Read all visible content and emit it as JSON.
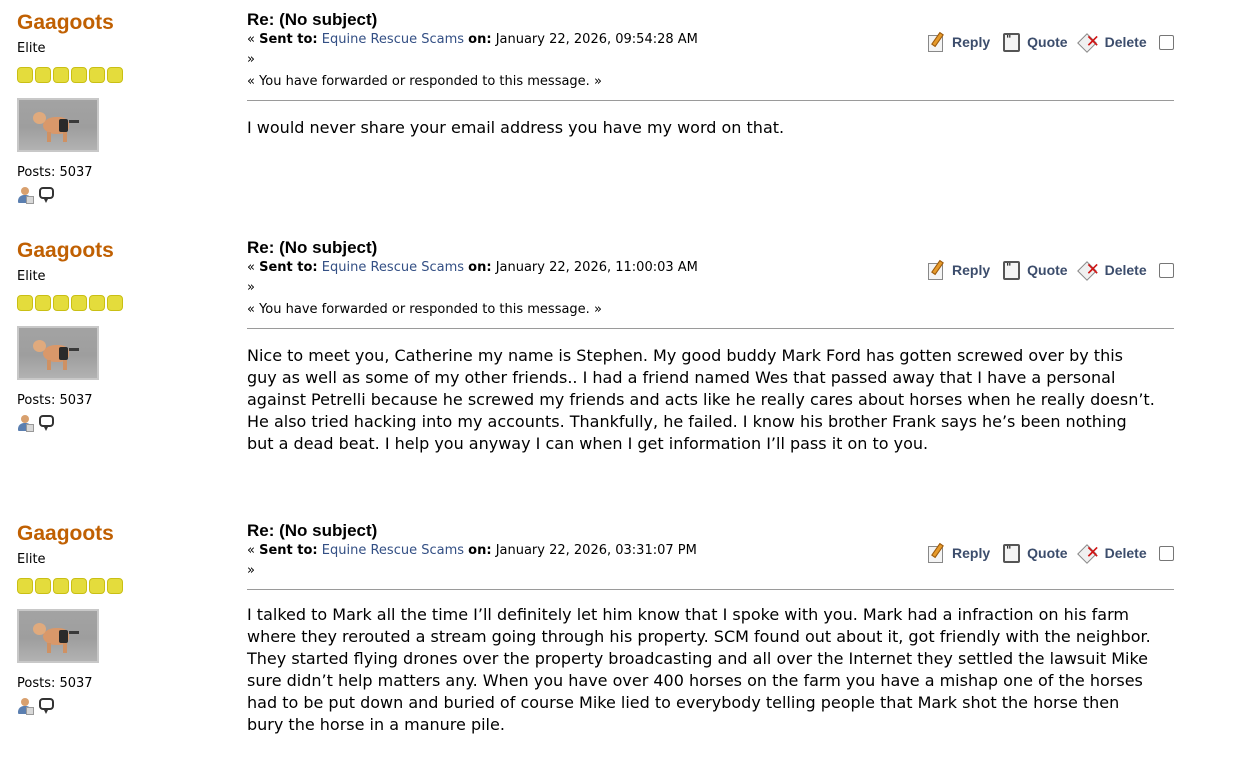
{
  "labels": {
    "sent_to": "Sent to:",
    "on": "on:",
    "open_quote": "«",
    "close_quote": "»",
    "reply": "Reply",
    "quote": "Quote",
    "delete": "Delete"
  },
  "posts": [
    {
      "poster_name": "Gaagoots",
      "poster_group": "Elite",
      "posts_count": "Posts: 5037",
      "subject": "Re: (No subject)",
      "recipient": "Equine Rescue Scams",
      "date": "January 22, 2026, 09:54:28 AM",
      "forwarded_note": "« You have forwarded or responded to this message. »",
      "body": "I would never share your email address you have my word on that."
    },
    {
      "poster_name": "Gaagoots",
      "poster_group": "Elite",
      "posts_count": "Posts: 5037",
      "subject": "Re: (No subject)",
      "recipient": "Equine Rescue Scams",
      "date": "January 22, 2026, 11:00:03 AM",
      "forwarded_note": "« You have forwarded or responded to this message. »",
      "body": "Nice to meet you, Catherine my name is Stephen. My good buddy Mark Ford has gotten screwed over by this guy as well as some of my other friends.. I had a friend named Wes that passed away that I have a personal against Petrelli because he screwed my friends and acts like he really cares about horses when he really doesn’t. He also tried hacking into my accounts. Thankfully, he failed. I know his brother Frank says he’s been nothing but a dead beat. I help you anyway I can when I get information I’ll pass it on to you."
    },
    {
      "poster_name": "Gaagoots",
      "poster_group": "Elite",
      "posts_count": "Posts: 5037",
      "subject": "Re: (No subject)",
      "recipient": "Equine Rescue Scams",
      "date": "January 22, 2026, 03:31:07 PM",
      "body": "I talked to Mark all the time I’ll definitely let him know that I spoke with you. Mark had a  infraction on his farm where they rerouted a stream going through his property. SCM found out about it, got friendly with the neighbor. They started flying drones over the property broadcasting and all over the Internet they settled the lawsuit Mike sure didn’t help matters any. When you have over 400 horses on the farm you have a mishap one of the horses had to be put down and buried of course Mike lied to everybody telling people that Mark shot the horse then bury the horse in a manure pile."
    }
  ]
}
